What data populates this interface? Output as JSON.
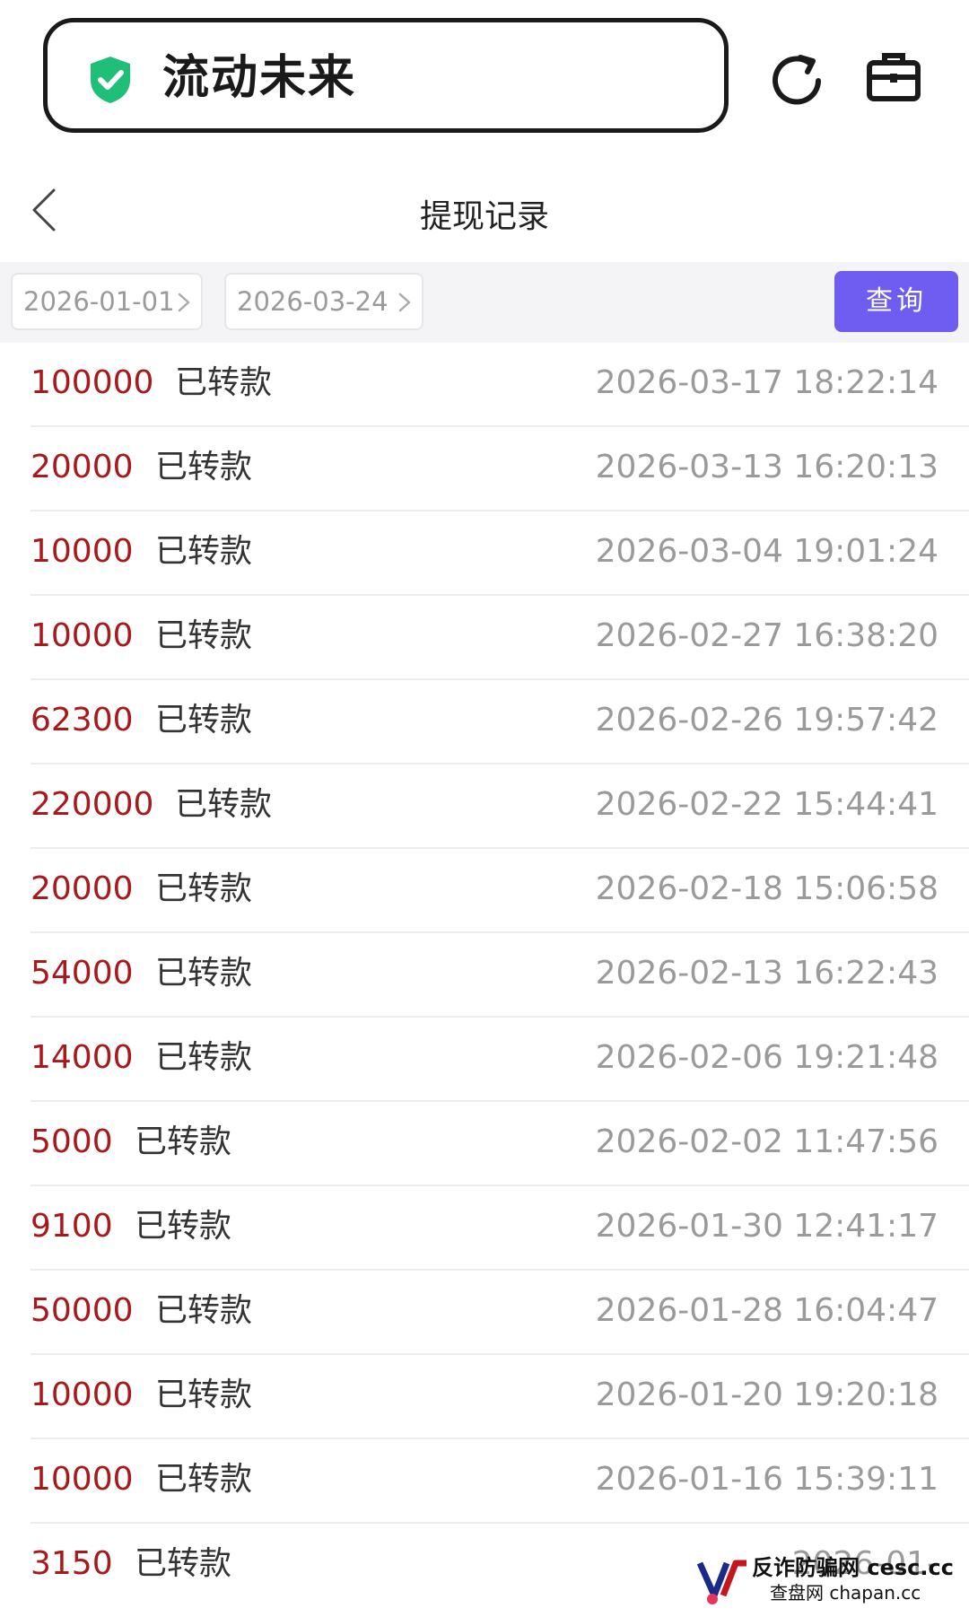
{
  "app_bar": {
    "app_name": "流动未来",
    "shield_color": "#1fbf7a",
    "icons": [
      "shield-check-icon",
      "refresh-icon",
      "briefcase-icon"
    ]
  },
  "header": {
    "title": "提现记录",
    "back_icon": "chevron-left-icon"
  },
  "filter": {
    "start_date": "2026-01-01",
    "end_date": "2026-03-24",
    "query_label": "查询",
    "query_color": "#6f5cf0"
  },
  "records": [
    {
      "amount": "100000",
      "status": "已转款",
      "time": "2026-03-17 18:22:14"
    },
    {
      "amount": "20000",
      "status": "已转款",
      "time": "2026-03-13 16:20:13"
    },
    {
      "amount": "10000",
      "status": "已转款",
      "time": "2026-03-04 19:01:24"
    },
    {
      "amount": "10000",
      "status": "已转款",
      "time": "2026-02-27 16:38:20"
    },
    {
      "amount": "62300",
      "status": "已转款",
      "time": "2026-02-26 19:57:42"
    },
    {
      "amount": "220000",
      "status": "已转款",
      "time": "2026-02-22 15:44:41"
    },
    {
      "amount": "20000",
      "status": "已转款",
      "time": "2026-02-18 15:06:58"
    },
    {
      "amount": "54000",
      "status": "已转款",
      "time": "2026-02-13 16:22:43"
    },
    {
      "amount": "14000",
      "status": "已转款",
      "time": "2026-02-06 19:21:48"
    },
    {
      "amount": "5000",
      "status": "已转款",
      "time": "2026-02-02 11:47:56"
    },
    {
      "amount": "9100",
      "status": "已转款",
      "time": "2026-01-30 12:41:17"
    },
    {
      "amount": "50000",
      "status": "已转款",
      "time": "2026-01-28 16:04:47"
    },
    {
      "amount": "10000",
      "status": "已转款",
      "time": "2026-01-20 19:20:18"
    },
    {
      "amount": "10000",
      "status": "已转款",
      "time": "2026-01-16 15:39:11"
    },
    {
      "amount": "3150",
      "status": "已转款",
      "time": "2026-01-"
    }
  ],
  "colors": {
    "amount": "#a8191b",
    "status": "#333333",
    "time": "#9a9a9a",
    "divider": "#ececec"
  },
  "watermark": {
    "line1": "反诈防骗网 cesc.cc",
    "line2": "查盘网 chapan.cc"
  }
}
